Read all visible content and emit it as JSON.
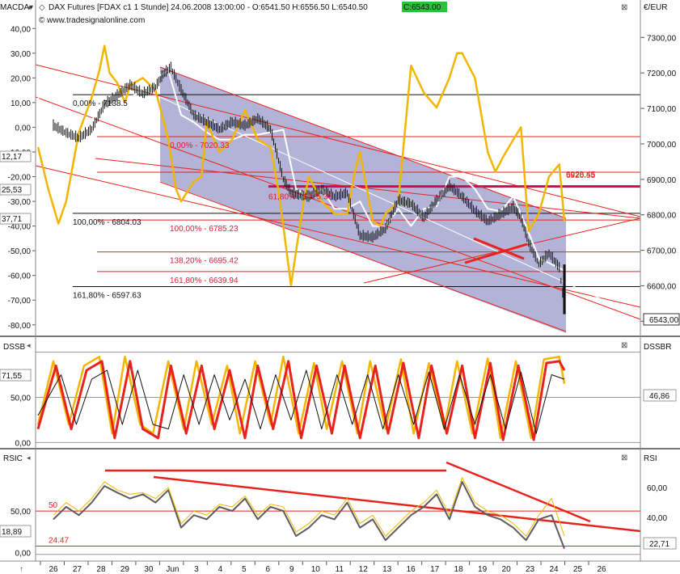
{
  "header": {
    "title": "DAX Futures [FDAX c1  1 Stunde] 24.06.2008 13:00:00 - O:6541.50 H:6556.50 L:6540.50",
    "close_label": "C:6543.00",
    "source": "© www.tradesignalonline.com",
    "top_left_label": "MACDA",
    "currency_label": "€/EUR"
  },
  "colors": {
    "white_line": "#ffffff",
    "yellow_line": "#f2b600",
    "red_line": "#e8221c",
    "dark_line": "#5c5c5c",
    "thin_line": "#111111",
    "channel_fill": "#a5a6d0",
    "fib_text": "#d1203a",
    "magenta_band": "#d10a56",
    "price_bars": "#111111"
  },
  "chart_data": [
    {
      "type": "line",
      "title": "DAX Futures [FDAX c1 1 Stunde]",
      "panel": "price-macd",
      "x_axis_labels": [
        "26",
        "27",
        "28",
        "29",
        "30",
        "Jun",
        "3",
        "4",
        "5",
        "6",
        "9",
        "10",
        "11",
        "12",
        "13",
        "16",
        "17",
        "18",
        "19",
        "20",
        "23",
        "24",
        "25",
        "26"
      ],
      "left_axis": {
        "label": "MACDA",
        "ticks": [
          40,
          30,
          20,
          10,
          0,
          -10,
          -20,
          -30,
          -40,
          -50,
          -60,
          -70,
          -80
        ],
        "tick_labels": [
          "40,00",
          "30,00",
          "20,00",
          "10,00",
          "0,00",
          "-10,00",
          "-20,00",
          "-30,00",
          "-40,00",
          "-50,00",
          "-60,00",
          "-70,00",
          "-80,00"
        ],
        "ylim": [
          -84,
          45
        ]
      },
      "right_axis": {
        "label": "€/EUR",
        "ticks": [
          7300,
          7200,
          7100,
          7000,
          6900,
          6800,
          6700,
          6600,
          6500
        ],
        "tick_labels": [
          "7300,00",
          "7200,00",
          "7100,00",
          "7000,00",
          "6900,00",
          "6800,00",
          "6700,00",
          "6600,00",
          "6500,00"
        ],
        "ylim": [
          6462,
          7360
        ]
      },
      "left_value_tags": [
        "12,17",
        "25,53",
        "37,71"
      ],
      "right_value_tag": "6543,00",
      "fib_labels_black": [
        "0,00% - 7138.5",
        "100,00% - 6804.03",
        "161,80% - 6597.63"
      ],
      "fib_labels_red": [
        "0,00% - 7020.33",
        "61,80% - 6875.36",
        "100,00% - 6785.23",
        "138,20% - 6695.42",
        "161,80% - 6639.94"
      ],
      "fib_levels_black": [
        7138.5,
        6804.03,
        6597.63
      ],
      "fib_levels_red": [
        7020.33,
        6875.36,
        6785.23,
        6695.42,
        6639.94
      ],
      "annotation_level_labels": [
        "6928.45",
        "6920.55"
      ],
      "price_series": {
        "name": "Price",
        "x": [
          26.0,
          26.5,
          27.0,
          27.5,
          28.0,
          28.5,
          29.0,
          29.5,
          30.0,
          30.3,
          30.6,
          31.0,
          31.5,
          32.0,
          32.5,
          33.0,
          33.5,
          34.0,
          34.5,
          35.0,
          35.3,
          35.6,
          36.0,
          36.5,
          37.0,
          37.5,
          38.0,
          38.5,
          39.0,
          39.5,
          40.0,
          40.5,
          41.0,
          41.5,
          42.0,
          42.5,
          43.0,
          43.5,
          44.0,
          44.3,
          44.6,
          45.0,
          45.4,
          45.8,
          46.0
        ],
        "y": [
          7050,
          7030,
          7015,
          7040,
          7110,
          7135,
          7165,
          7140,
          7160,
          7195,
          7215,
          7150,
          7080,
          7060,
          7040,
          7060,
          7050,
          7070,
          7040,
          6900,
          6860,
          6855,
          6850,
          6870,
          6850,
          6860,
          6740,
          6735,
          6760,
          6840,
          6830,
          6790,
          6840,
          6880,
          6850,
          6810,
          6780,
          6800,
          6820,
          6790,
          6720,
          6660,
          6690,
          6650,
          6543
        ]
      },
      "yellow_series": {
        "name": "",
        "x": [
          25.4,
          25.8,
          26.2,
          26.5,
          27.0,
          27.5,
          27.8,
          28.0,
          28.2,
          28.5,
          28.8,
          29.0,
          29.5,
          30.0,
          30.5,
          30.8,
          31.0,
          31.5,
          31.8,
          32.0,
          32.5,
          33.0,
          33.5,
          34.0,
          34.5,
          34.8,
          35.0,
          35.3,
          35.5,
          35.8,
          36.0,
          36.5,
          37.0,
          37.5,
          37.8,
          38.0,
          38.5,
          38.8,
          39.0,
          39.5,
          40.0,
          40.5,
          41.0,
          41.5,
          41.8,
          42.0,
          42.5,
          43.0,
          43.3,
          43.6,
          44.0,
          44.3,
          44.6,
          45.0,
          45.4,
          45.8,
          46.0
        ],
        "y": [
          -8,
          -25,
          -39,
          -30,
          -2,
          12,
          23,
          33,
          22,
          18,
          10,
          17,
          20,
          15,
          -5,
          -25,
          -30,
          -22,
          -20,
          2,
          -10,
          -5,
          7,
          -5,
          -8,
          -25,
          -40,
          -64,
          -50,
          -30,
          -20,
          -30,
          -35,
          -35,
          -18,
          -10,
          -38,
          -40,
          -35,
          -30,
          25,
          14,
          8,
          20,
          30,
          30,
          20,
          -10,
          -18,
          -12,
          -5,
          0,
          -42,
          -35,
          -20,
          -15,
          -38
        ]
      },
      "white_series": {
        "name": "",
        "x": [
          25.4,
          25.8,
          26.5,
          27.0,
          27.5,
          28.0,
          28.5,
          29.0,
          29.5,
          30.0,
          30.5,
          31.0,
          31.5,
          32.0,
          32.5,
          33.0,
          33.5,
          34.0,
          34.5,
          35.0,
          35.5,
          36.0,
          36.5,
          37.0,
          37.5,
          38.0,
          38.5,
          39.0,
          39.5,
          40.0,
          40.5,
          41.0,
          41.5,
          42.0,
          42.5,
          43.0,
          43.5,
          44.0,
          44.5,
          45.0,
          45.4,
          45.8,
          46.0
        ],
        "y": [
          12,
          0,
          0,
          3,
          3,
          8,
          11,
          12,
          15,
          20,
          23,
          5,
          2,
          -2,
          -5,
          -5,
          -3,
          -3,
          -2,
          -1,
          -25,
          -28,
          -25,
          -33,
          -33,
          -30,
          -40,
          -40,
          -33,
          -40,
          -33,
          -32,
          -20,
          -20,
          -25,
          -33,
          -34,
          -28,
          -40,
          -53,
          -55,
          -57,
          -58
        ]
      }
    },
    {
      "type": "line",
      "panel": "dssb",
      "title": "DSSB",
      "right_label": "DSSBR",
      "left_axis": {
        "ticks": [
          50,
          0
        ],
        "tick_labels": [
          "50,00",
          "0,00"
        ],
        "ylim": [
          -5,
          105
        ]
      },
      "left_value_tag": "71,55",
      "right_value_tag": "46,86",
      "series": [
        {
          "name": "",
          "x": [
            25.4,
            26.0,
            26.6,
            27.2,
            27.8,
            28.3,
            28.8,
            29.4,
            29.9,
            30.5,
            31.1,
            31.6,
            32.2,
            32.8,
            33.3,
            33.9,
            34.5,
            35.0,
            35.6,
            36.2,
            36.7,
            37.3,
            37.9,
            38.4,
            39.0,
            39.6,
            40.1,
            40.7,
            41.3,
            41.8,
            42.4,
            43.0,
            43.5,
            44.1,
            44.7,
            45.2,
            45.8,
            46.0
          ],
          "y": [
            20,
            90,
            20,
            85,
            95,
            10,
            95,
            20,
            10,
            90,
            15,
            90,
            20,
            85,
            10,
            90,
            20,
            95,
            10,
            88,
            15,
            90,
            10,
            90,
            15,
            92,
            10,
            88,
            15,
            90,
            10,
            93,
            5,
            90,
            5,
            92,
            95,
            65
          ]
        },
        {
          "name": "",
          "x": [
            25.4,
            26.1,
            26.7,
            27.3,
            27.9,
            28.4,
            29.0,
            29.5,
            30.1,
            30.6,
            31.2,
            31.8,
            32.3,
            32.9,
            33.5,
            34.0,
            34.6,
            35.2,
            35.7,
            36.3,
            36.9,
            37.4,
            38.0,
            38.6,
            39.1,
            39.7,
            40.3,
            40.8,
            41.4,
            42.0,
            42.5,
            43.1,
            43.6,
            44.2,
            44.8,
            45.3,
            45.8,
            46.0
          ],
          "y": [
            15,
            85,
            15,
            80,
            90,
            5,
            90,
            15,
            5,
            85,
            10,
            85,
            15,
            80,
            5,
            85,
            15,
            90,
            5,
            85,
            10,
            85,
            5,
            85,
            10,
            88,
            5,
            85,
            10,
            85,
            5,
            88,
            3,
            85,
            3,
            88,
            90,
            80
          ]
        },
        {
          "name": "",
          "x": [
            25.4,
            26.3,
            26.9,
            27.5,
            28.1,
            28.7,
            29.3,
            29.9,
            30.5,
            31.1,
            31.7,
            32.3,
            32.9,
            33.5,
            34.1,
            34.7,
            35.3,
            35.9,
            36.5,
            37.1,
            37.7,
            38.3,
            38.9,
            39.5,
            40.1,
            40.7,
            41.3,
            41.9,
            42.5,
            43.1,
            43.7,
            44.3,
            44.9,
            45.5,
            46.0
          ],
          "y": [
            30,
            75,
            20,
            70,
            80,
            20,
            80,
            20,
            15,
            75,
            20,
            75,
            25,
            70,
            15,
            75,
            25,
            80,
            15,
            75,
            20,
            75,
            15,
            75,
            20,
            78,
            15,
            75,
            20,
            75,
            15,
            78,
            10,
            75,
            70
          ]
        }
      ]
    },
    {
      "type": "line",
      "panel": "rsic",
      "title": "RSIC",
      "right_label": "RSI",
      "left_axis": {
        "ticks": [
          50,
          0
        ],
        "tick_labels": [
          "50,00",
          "0,00"
        ],
        "ylim": [
          -8,
          112
        ]
      },
      "right_axis": {
        "ticks": [
          60,
          40
        ],
        "tick_labels": [
          "60,00",
          "40,00"
        ]
      },
      "left_value_tag": "18,89",
      "right_value_tag": "22,71",
      "level_labels": [
        "50",
        "24.47"
      ],
      "series": [
        {
          "name": "",
          "x": [
            26.0,
            26.5,
            27.0,
            27.5,
            28.0,
            28.5,
            29.0,
            29.5,
            30.0,
            30.5,
            31.0,
            31.5,
            32.0,
            32.5,
            33.0,
            33.5,
            34.0,
            34.5,
            35.0,
            35.5,
            36.0,
            36.5,
            37.0,
            37.5,
            38.0,
            38.5,
            39.0,
            39.5,
            40.0,
            40.5,
            41.0,
            41.5,
            42.0,
            42.5,
            43.0,
            43.5,
            44.0,
            44.5,
            45.0,
            45.5,
            46.0
          ],
          "y": [
            40,
            55,
            45,
            60,
            80,
            72,
            65,
            70,
            60,
            75,
            30,
            45,
            40,
            55,
            50,
            65,
            40,
            55,
            50,
            20,
            30,
            45,
            40,
            60,
            30,
            40,
            15,
            30,
            45,
            55,
            70,
            40,
            85,
            55,
            45,
            40,
            30,
            15,
            40,
            45,
            5
          ]
        },
        {
          "name": "",
          "x": [
            26.0,
            26.5,
            27.0,
            27.5,
            28.0,
            28.5,
            29.0,
            29.5,
            30.0,
            30.5,
            31.0,
            31.5,
            32.0,
            32.5,
            33.0,
            33.5,
            34.0,
            34.5,
            35.0,
            35.5,
            36.0,
            36.5,
            37.0,
            37.5,
            38.0,
            38.5,
            39.0,
            39.5,
            40.0,
            40.5,
            41.0,
            41.5,
            42.0,
            42.5,
            43.0,
            43.5,
            44.0,
            44.5,
            45.0,
            45.5,
            46.0
          ],
          "y": [
            45,
            60,
            50,
            65,
            85,
            75,
            70,
            72,
            65,
            78,
            35,
            50,
            45,
            58,
            55,
            68,
            45,
            58,
            55,
            25,
            35,
            50,
            45,
            65,
            35,
            45,
            20,
            35,
            50,
            60,
            75,
            45,
            90,
            60,
            50,
            45,
            35,
            20,
            45,
            65,
            20
          ]
        }
      ]
    }
  ]
}
